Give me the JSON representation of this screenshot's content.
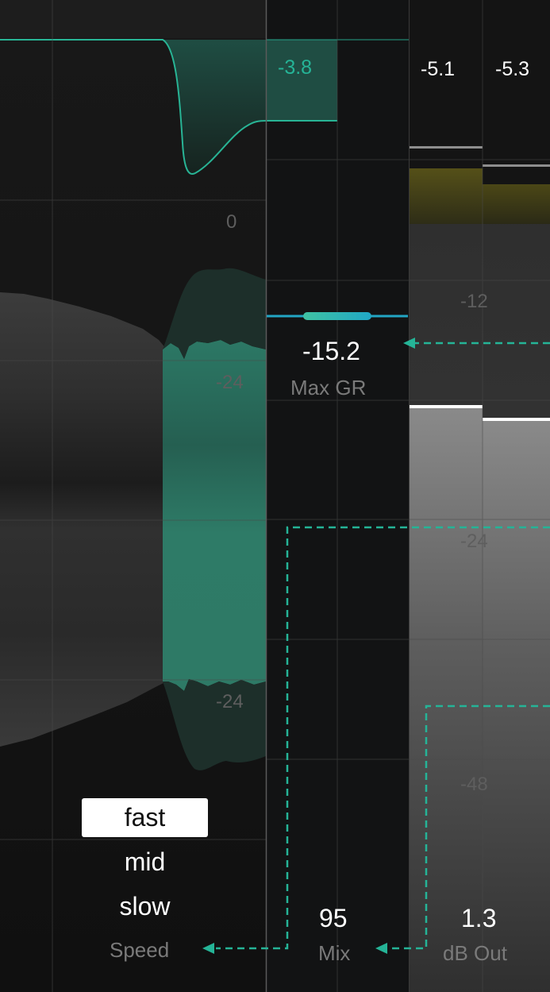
{
  "meters": {
    "gain_reduction_top": "-3.8",
    "out_left_peak": "-5.1",
    "out_right_peak": "-5.3"
  },
  "grid_labels": {
    "zero": "0",
    "minus24_upper": "-24",
    "minus24_lower": "-24",
    "minus12": "-12",
    "minus24_right": "-24",
    "minus48": "-48"
  },
  "max_gr": {
    "value": "-15.2",
    "label": "Max GR"
  },
  "speed": {
    "options": [
      "fast",
      "mid",
      "slow"
    ],
    "selected": "fast",
    "label": "Speed"
  },
  "mix": {
    "value": "95",
    "label": "Mix"
  },
  "output": {
    "value": "1.3",
    "label": "dB Out"
  },
  "colors": {
    "accent": "#25b497",
    "accent_fill": "#2f7a68",
    "background": "#111213",
    "meter_yellow": "#4c4a18"
  }
}
